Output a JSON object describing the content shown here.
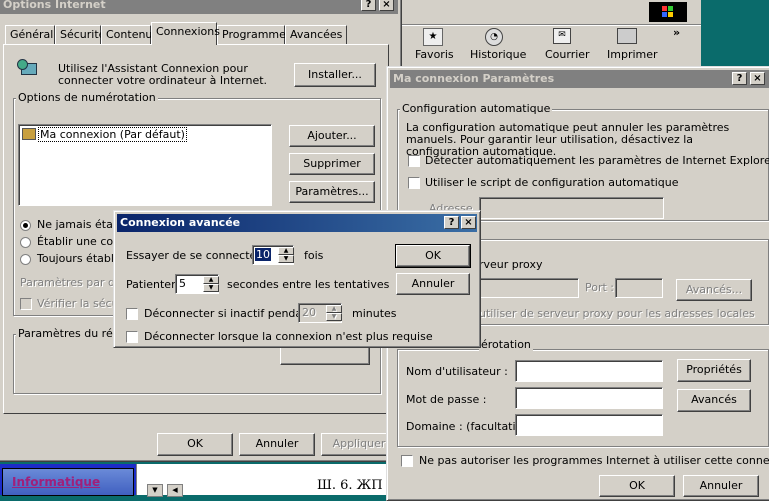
{
  "internet_options": {
    "title": "Options Internet",
    "tabs": [
      "Général",
      "Sécurité",
      "Contenu",
      "Connexions",
      "Programmes",
      "Avancées"
    ],
    "active_tab": "Connexions",
    "assistant_text": "Utilisez l'Assistant Connexion pour connecter votre ordinateur à Internet.",
    "install_button": "Installer...",
    "dialup_group": "Options de numérotation",
    "connections": [
      "Ma connexion (Par défaut)"
    ],
    "add_button": "Ajouter...",
    "remove_button": "Supprimer",
    "settings_button": "Paramètres...",
    "radio_never": "Ne jamais établir",
    "radio_when": "Établir une conn",
    "radio_always": "Toujours établir l",
    "params_default": "Paramètres par défa",
    "verify_security": "Vérifier la sécurit",
    "lan_group": "Paramètres du résea",
    "ok": "OK",
    "cancel": "Annuler",
    "apply": "Appliquer"
  },
  "browser_toolbar": {
    "buttons": [
      {
        "label": "Favoris",
        "icon": "favorites-icon"
      },
      {
        "label": "Historique",
        "icon": "history-icon"
      },
      {
        "label": "Courrier",
        "icon": "mail-icon"
      },
      {
        "label": "Imprimer",
        "icon": "print-icon"
      }
    ],
    "chevron": "»"
  },
  "taskbar": {
    "item": "Informatique",
    "text": "Ш. 6. ЖП"
  },
  "connection_settings": {
    "title": "Ma connexion Paramètres",
    "auto_group": "Configuration automatique",
    "auto_text": "La configuration automatique peut annuler les paramètres manuels. Pour garantir leur utilisation, désactivez la configuration automatique.",
    "detect_label": "Détecter automatiquement les paramètres de Internet Explorer",
    "script_label": "Utiliser le script de configuration automatique",
    "address_label": "Adresse",
    "proxy_fragment": "rveur proxy",
    "port_label": "Port :",
    "advanced_button": "Avancés...",
    "bypass_local": "utiliser de serveur proxy pour les adresses locales",
    "dialup_fragment": "érotation",
    "username_label": "Nom d'utilisateur :",
    "password_label": "Mot de passe :",
    "domain_label": "Domaine : (facultatif)",
    "properties_button": "Propriétés",
    "advanced2_button": "Avancés",
    "no_other_programs": "Ne pas autoriser les programmes Internet à utiliser cette connexion",
    "ok": "OK",
    "cancel": "Annuler"
  },
  "advanced_connection": {
    "title": "Connexion avancée",
    "try_label": "Essayer de se connecter",
    "try_value": "10",
    "try_unit": "fois",
    "wait_label": "Patienter",
    "wait_value": "5",
    "wait_unit": "secondes entre les tentatives",
    "idle_label": "Déconnecter si inactif pendant",
    "idle_value": "20",
    "idle_unit": "minutes",
    "disconnect_label": "Déconnecter lorsque la connexion n'est plus requise",
    "ok": "OK",
    "cancel": "Annuler"
  },
  "title_buttons": {
    "help": "?",
    "close": "×"
  }
}
